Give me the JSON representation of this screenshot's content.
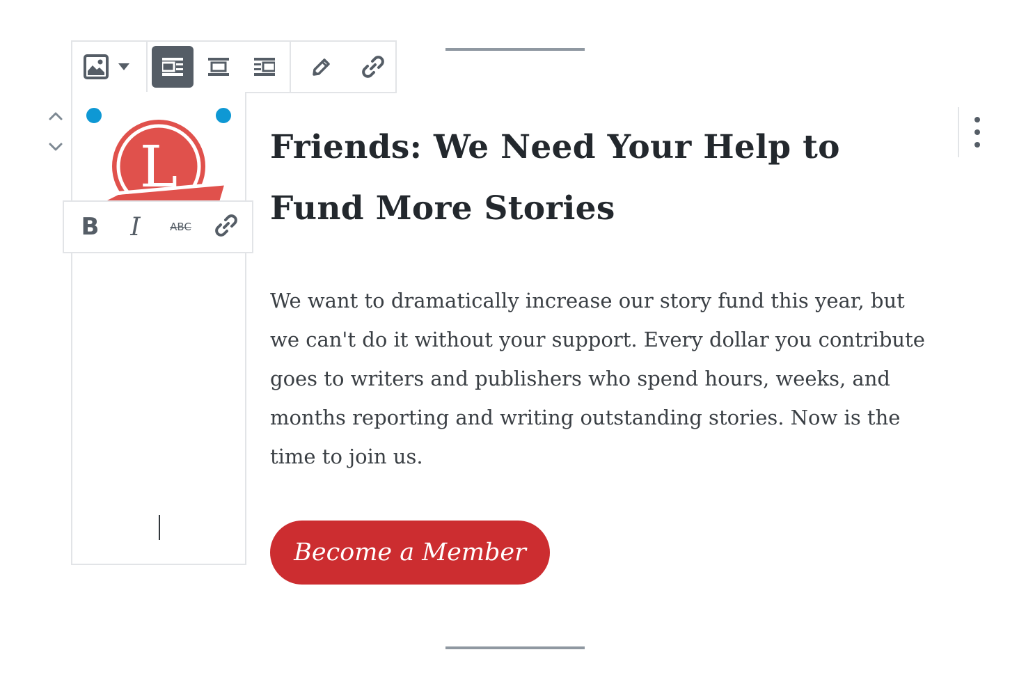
{
  "block_toolbar": {
    "block_type_icon": "image-icon",
    "block_type_menu_icon": "dropdown-triangle-icon",
    "alignment_options": [
      {
        "icon": "media-left-align-icon",
        "active": true
      },
      {
        "icon": "align-center-icon",
        "active": false
      },
      {
        "icon": "media-right-align-icon",
        "active": false
      }
    ],
    "edit_icon": "pencil-icon",
    "link_icon": "link-icon"
  },
  "format_toolbar": {
    "bold_label": "B",
    "italic_label": "I",
    "strikethrough_label": "ABC",
    "link_icon": "link-icon"
  },
  "media": {
    "logo_letter": "L"
  },
  "content": {
    "heading": "Friends: We Need Your Help to Fund More Stories",
    "paragraph": "We want to dramatically increase our story fund this year, but we can't do it without your support. Every dollar you contribute goes to writers and publishers who spend hours, weeks, and months reporting and writing outstanding stories. Now is the time to join us.",
    "button_label": "Become a Member"
  },
  "colors": {
    "button_background": "#cc2d30",
    "handle": "#0e98d4",
    "active_toolbar_button": "#555d66",
    "logo_red": "#e0514c"
  }
}
